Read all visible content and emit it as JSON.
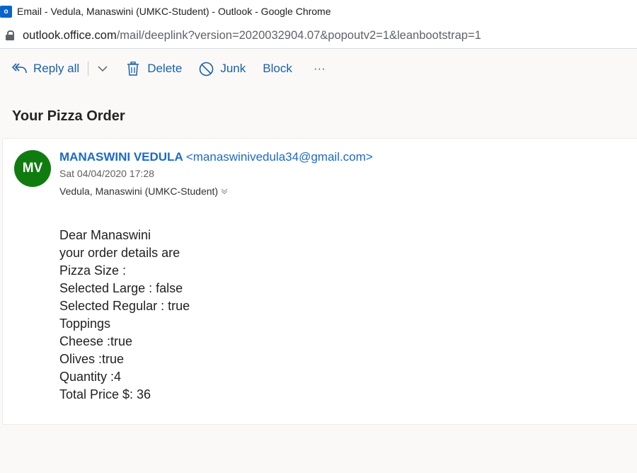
{
  "window": {
    "title": "Email - Vedula, Manaswini (UMKC-Student) - Outlook - Google Chrome"
  },
  "address_bar": {
    "host": "outlook.office.com",
    "path": "/mail/deeplink?version=2020032904.07&popoutv2=1&leanbootstrap=1"
  },
  "toolbar": {
    "reply_all_label": "Reply all",
    "delete_label": "Delete",
    "junk_label": "Junk",
    "block_label": "Block",
    "more_label": "···"
  },
  "message": {
    "subject": "Your Pizza Order",
    "avatar_initials": "MV",
    "avatar_color": "#107c10",
    "sender_name": "MANASWINI VEDULA",
    "sender_email": "<manaswinivedula34@gmail.com>",
    "date": "Sat 04/04/2020 17:28",
    "recipient": "Vedula, Manaswini (UMKC-Student)",
    "body_lines": [
      "Dear Manaswini",
      "your order details are",
      "Pizza Size :",
      "Selected Large : false",
      "Selected Regular : true",
      "Toppings",
      "Cheese :true",
      "Olives :true",
      "Quantity :4",
      "Total Price $: 36"
    ]
  },
  "colors": {
    "accent": "#1b5fa8",
    "link": "#1b6ac9"
  }
}
